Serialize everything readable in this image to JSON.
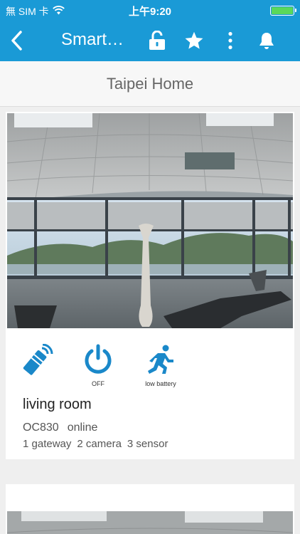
{
  "status_bar": {
    "carrier": "無 SIM 卡",
    "time": "上午9:20",
    "wifi_icon": "wifi-icon",
    "battery_icon": "battery-icon"
  },
  "navbar": {
    "title": "Smart…",
    "back_icon": "chevron-left-icon",
    "actions": [
      "lock-open-icon",
      "star-icon",
      "more-vertical-icon",
      "bell-icon"
    ]
  },
  "home": {
    "name": "Taipei Home"
  },
  "devices": [
    {
      "room": "living room",
      "model": "OC830",
      "status": "online",
      "gateways": "1 gateway",
      "cameras": "2 camera",
      "sensors": "3 sensor",
      "icons": [
        {
          "icon": "remote-signal-icon",
          "caption": ""
        },
        {
          "icon": "power-icon",
          "caption": "OFF"
        },
        {
          "icon": "running-person-icon",
          "caption": "low battery"
        }
      ]
    }
  ],
  "colors": {
    "primary": "#1a9ad6",
    "icon_blue": "#1a88c9",
    "background": "#efefef"
  }
}
